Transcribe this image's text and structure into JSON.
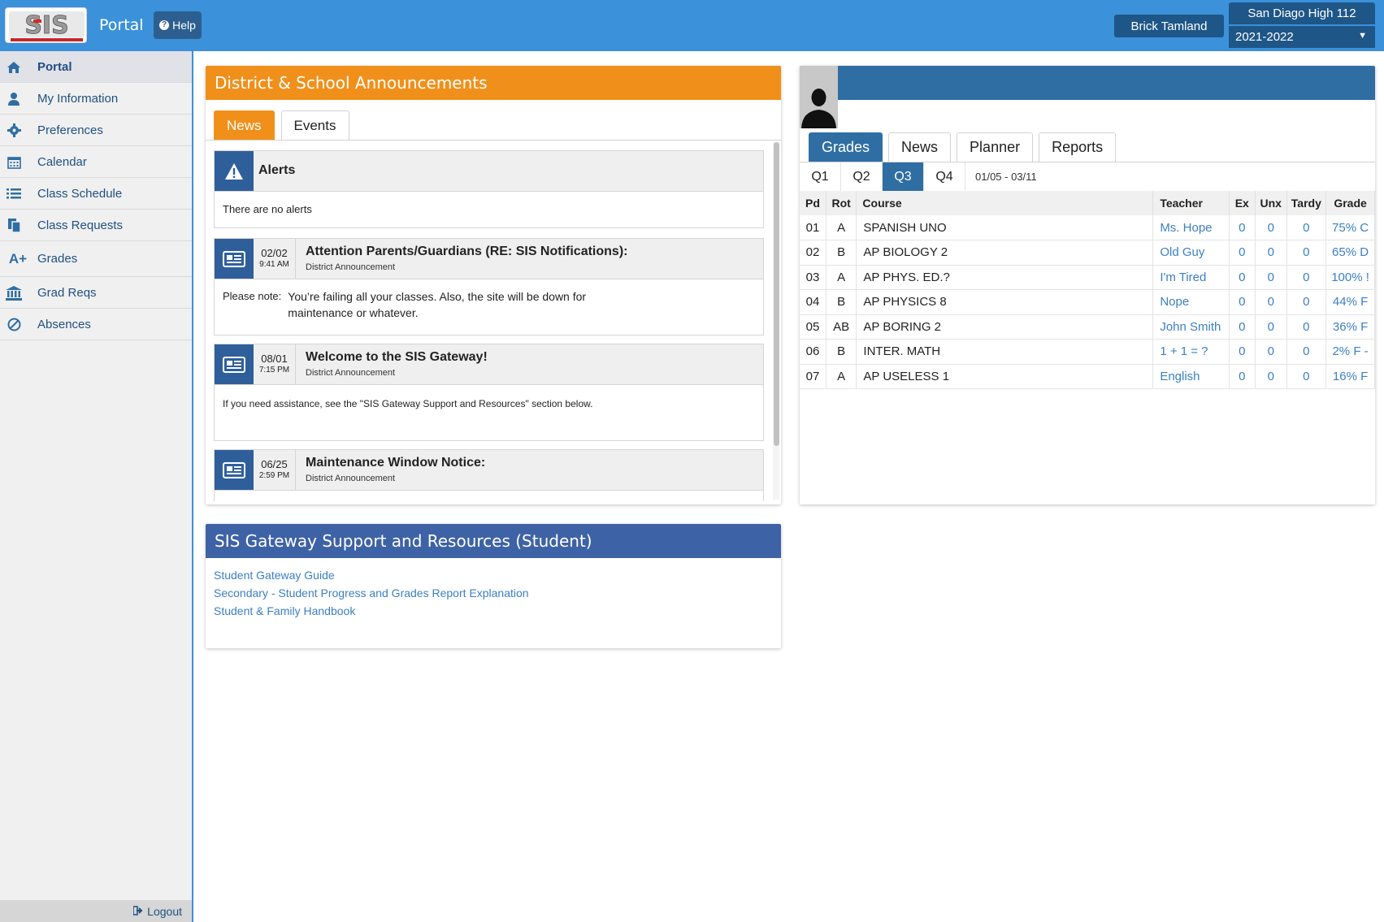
{
  "header": {
    "portal_title": "Portal",
    "help_label": "Help",
    "user_name": "Brick  Tamland",
    "school_name": "San Diago High 112",
    "school_year": "2021-2022"
  },
  "sidebar": {
    "items": [
      {
        "label": "Portal",
        "icon": "home-icon"
      },
      {
        "label": "My Information",
        "icon": "user-icon"
      },
      {
        "label": "Preferences",
        "icon": "gear-icon"
      },
      {
        "label": "Calendar",
        "icon": "calendar-icon"
      },
      {
        "label": "Class Schedule",
        "icon": "list-icon"
      },
      {
        "label": "Class Requests",
        "icon": "copy-icon"
      },
      {
        "label": "Grades",
        "icon": "a-plus-icon"
      },
      {
        "label": "Grad Reqs",
        "icon": "institution-icon"
      },
      {
        "label": "Absences",
        "icon": "ban-icon"
      }
    ],
    "logout_label": "Logout",
    "a_plus": "A+"
  },
  "announcements": {
    "title": "District & School Announcements",
    "tabs": [
      "News",
      "Events"
    ],
    "alerts": {
      "title": "Alerts",
      "body": "There are no alerts"
    },
    "items": [
      {
        "date": "02/02",
        "time": "9:41 AM",
        "title": "Attention Parents/Guardians (RE: SIS Notifications):",
        "subtitle": "District Announcement",
        "note_label": "Please note:",
        "body": "You’re failing all your classes. Also, the site will be down for maintenance or whatever."
      },
      {
        "date": "08/01",
        "time": "7:15 PM",
        "title": "Welcome to the SIS Gateway!",
        "subtitle": "District Announcement",
        "body": "If you need assistance, see the \"SIS Gateway Support and Resources\" section below."
      },
      {
        "date": "06/25",
        "time": "2:59 PM",
        "title": "Maintenance Window Notice:",
        "subtitle": "District Announcement"
      }
    ]
  },
  "support": {
    "title": "SIS Gateway Support and Resources (Student)",
    "links": [
      "Student Gateway Guide",
      "Secondary - Student Progress and Grades Report Explanation",
      "Student & Family Handbook"
    ]
  },
  "student": {
    "tabs": [
      "Grades",
      "News",
      "Planner",
      "Reports"
    ],
    "quarters": [
      "Q1",
      "Q2",
      "Q3",
      "Q4"
    ],
    "date_range": "01/05 - 03/11",
    "columns": [
      "Pd",
      "Rot",
      "Course",
      "Teacher",
      "Ex",
      "Unx",
      "Tardy",
      "Grade"
    ],
    "rows": [
      {
        "pd": "01",
        "rot": "A",
        "course": "SPANISH UNO",
        "teacher": "Ms. Hope",
        "ex": "0",
        "unx": "0",
        "tardy": "0",
        "grade": "75% C"
      },
      {
        "pd": "02",
        "rot": "B",
        "course": "AP BIOLOGY 2",
        "teacher": "Old Guy",
        "ex": "0",
        "unx": "0",
        "tardy": "0",
        "grade": "65% D"
      },
      {
        "pd": "03",
        "rot": "A",
        "course": "AP PHYS. ED.?",
        "teacher": "I'm Tired",
        "ex": "0",
        "unx": "0",
        "tardy": "0",
        "grade": "100% !"
      },
      {
        "pd": "04",
        "rot": "B",
        "course": "AP PHYSICS 8",
        "teacher": "Nope",
        "ex": "0",
        "unx": "0",
        "tardy": "0",
        "grade": "44% F"
      },
      {
        "pd": "05",
        "rot": "AB",
        "course": "AP BORING 2",
        "teacher": "John Smith",
        "ex": "0",
        "unx": "0",
        "tardy": "0",
        "grade": "36% F"
      },
      {
        "pd": "06",
        "rot": "B",
        "course": "INTER. MATH",
        "teacher": "1 + 1 = ?",
        "ex": "0",
        "unx": "0",
        "tardy": "0",
        "grade": "2% F -"
      },
      {
        "pd": "07",
        "rot": "A",
        "course": "AP USELESS 1",
        "teacher": "English",
        "ex": "0",
        "unx": "0",
        "tardy": "0",
        "grade": "16% F"
      }
    ]
  },
  "colors": {
    "header_blue": "#3b91da",
    "orange": "#f0901a",
    "panel_blue": "#3e62a6",
    "student_blue": "#2f6ea3",
    "link_blue": "#3b7fc4"
  }
}
